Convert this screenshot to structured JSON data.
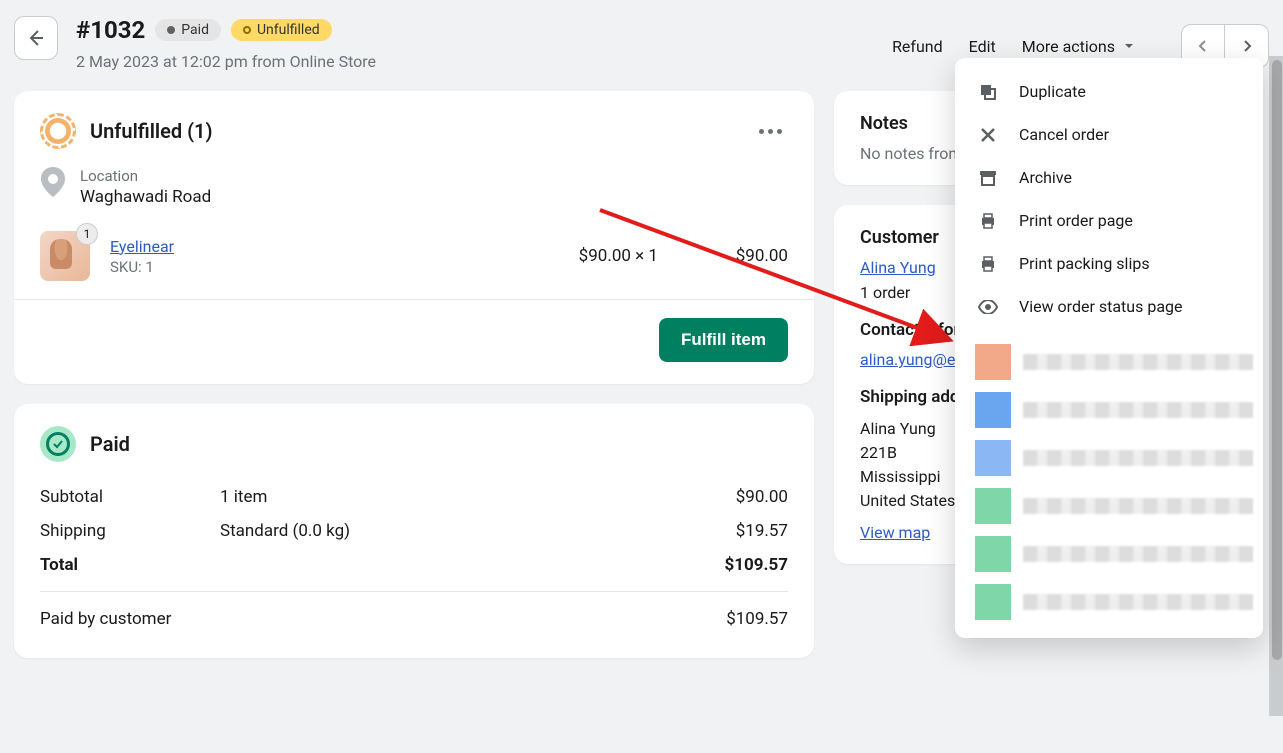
{
  "header": {
    "order_number": "#1032",
    "paid_badge": "Paid",
    "unfulfilled_badge": "Unfulfilled",
    "timestamp": "2 May 2023 at 12:02 pm from Online Store",
    "refund": "Refund",
    "edit": "Edit",
    "more_actions": "More actions"
  },
  "more_actions_menu": {
    "duplicate": "Duplicate",
    "cancel": "Cancel order",
    "archive": "Archive",
    "print_order": "Print order page",
    "print_slips": "Print packing slips",
    "view_status": "View order status page"
  },
  "fulfillment": {
    "title": "Unfulfilled (1)",
    "location_label": "Location",
    "location_value": "Waghawadi Road",
    "item": {
      "name": "Eyelinear",
      "sku": "SKU: 1",
      "badge_qty": "1",
      "unit_price_qty": "$90.00 × 1",
      "line_total": "$90.00"
    },
    "fulfill_button": "Fulfill item"
  },
  "payment": {
    "title": "Paid",
    "subtotal_label": "Subtotal",
    "subtotal_mid": "1 item",
    "subtotal_val": "$90.00",
    "shipping_label": "Shipping",
    "shipping_mid": "Standard (0.0 kg)",
    "shipping_val": "$19.57",
    "total_label": "Total",
    "total_val": "$109.57",
    "paid_by_label": "Paid by customer",
    "paid_by_val": "$109.57"
  },
  "notes": {
    "title": "Notes",
    "empty": "No notes from customer"
  },
  "customer": {
    "title": "Customer",
    "name": "Alina Yung",
    "orders": "1 order",
    "contact_title": "Contact information",
    "email": "alina.yung@example.com",
    "shipping_title": "Shipping address",
    "line1": "Alina Yung",
    "line2": "221B",
    "line3": "Mississippi",
    "line4": "United States",
    "view_map": "View map"
  }
}
